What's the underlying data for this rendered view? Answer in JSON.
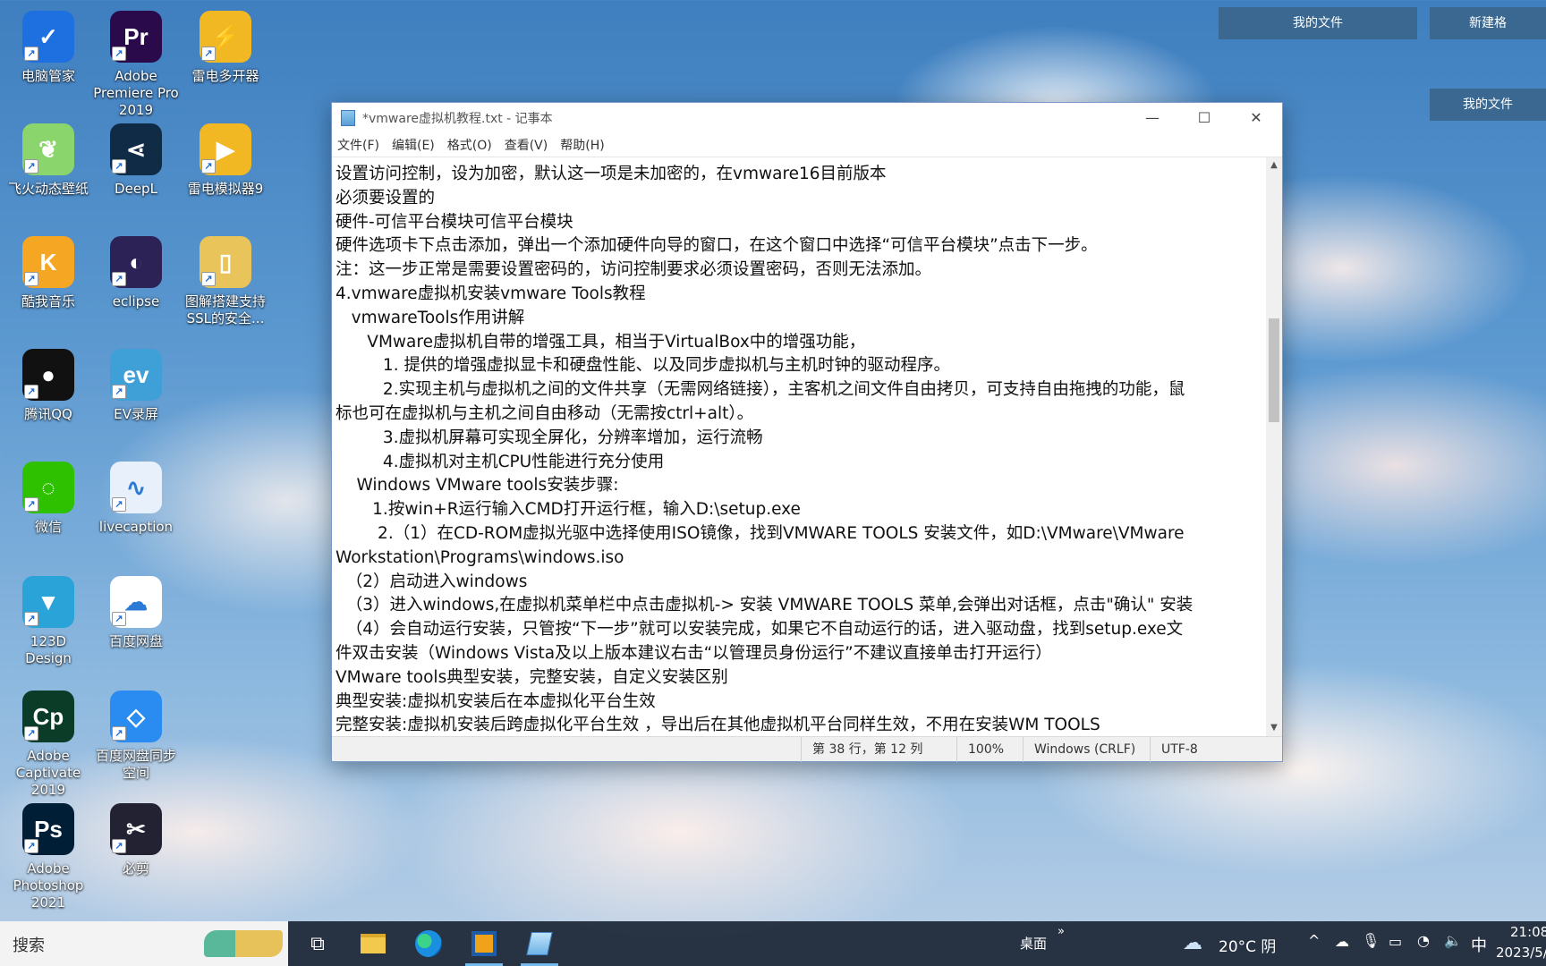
{
  "desktop": {
    "icons": [
      {
        "label": "电脑管家",
        "color": "#1e6fe0",
        "glyph": "✓",
        "icon": "shield-icon"
      },
      {
        "label": "Adobe Premiere Pro 2019",
        "color": "#2a0a4a",
        "glyph": "Pr",
        "icon": "premiere-icon"
      },
      {
        "label": "雷电多开器",
        "color": "#f2b824",
        "glyph": "⚡",
        "icon": "multi-open-icon"
      },
      {
        "label": "飞火动态壁纸",
        "color": "#8ad66c",
        "glyph": "❦",
        "icon": "leaf-icon"
      },
      {
        "label": "DeepL",
        "color": "#0f2b46",
        "glyph": "⋖",
        "icon": "deepl-icon"
      },
      {
        "label": "雷电模拟器9",
        "color": "#f2b824",
        "glyph": "▶",
        "icon": "emulator-icon"
      },
      {
        "label": "酷我音乐",
        "color": "#f5a623",
        "glyph": "K",
        "icon": "music-icon"
      },
      {
        "label": "eclipse",
        "color": "#2c2255",
        "glyph": "◐",
        "icon": "eclipse-icon"
      },
      {
        "label": "图解搭建支持SSL的安全...",
        "color": "#e9c45a",
        "glyph": "▯",
        "icon": "folder-icon"
      },
      {
        "label": "腾讯QQ",
        "color": "#111111",
        "glyph": "●",
        "icon": "qq-penguin-icon"
      },
      {
        "label": "EV录屏",
        "color": "#3fa0d8",
        "glyph": "ev",
        "icon": "ev-recorder-icon"
      },
      {
        "label": "微信",
        "color": "#2dc100",
        "glyph": "◌",
        "icon": "wechat-icon"
      },
      {
        "label": "livecaption",
        "color": "#e8f1fb",
        "glyph": "∿",
        "icon": "audio-wave-icon"
      },
      {
        "label": "123D Design",
        "color": "#29a3d8",
        "glyph": "▼",
        "icon": "123d-icon"
      },
      {
        "label": "百度网盘",
        "color": "#ffffff",
        "glyph": "☁",
        "icon": "baidu-cloud-icon"
      },
      {
        "label": "Adobe Captivate 2019",
        "color": "#0a3c28",
        "glyph": "Cp",
        "icon": "captivate-icon"
      },
      {
        "label": "百度网盘同步空间",
        "color": "#2a8cf0",
        "glyph": "◇",
        "icon": "sync-space-icon"
      },
      {
        "label": "Adobe Photoshop 2021",
        "color": "#001e36",
        "glyph": "Ps",
        "icon": "photoshop-icon"
      },
      {
        "label": "必剪",
        "color": "#222233",
        "glyph": "✂",
        "icon": "bijian-icon"
      }
    ],
    "floating": {
      "my_files_1": "我的文件",
      "new_tab": "新建格",
      "my_files_2": "我的文件"
    }
  },
  "notepad": {
    "title": "*vmware虚拟机教程.txt - 记事本",
    "menu": [
      "文件(F)",
      "编辑(E)",
      "格式(O)",
      "查看(V)",
      "帮助(H)"
    ],
    "lines": [
      "设置访问控制，设为加密，默认这一项是未加密的，在vmware16目前版本",
      "必须要设置的",
      "硬件-可信平台模块可信平台模块",
      "硬件选项卡下点击添加，弹出一个添加硬件向导的窗口，在这个窗口中选择“可信平台模块”点击下一步。",
      "注：这一步正常是需要设置密码的，访问控制要求必须设置密码，否则无法添加。",
      "4.vmware虚拟机安装vmware Tools教程",
      "   vmwareTools作用讲解",
      "      VMware虚拟机自带的增强工具，相当于VirtualBox中的增强功能，",
      "         1. 提供的增强虚拟显卡和硬盘性能、以及同步虚拟机与主机时钟的驱动程序。",
      "         2.实现主机与虚拟机之间的文件共享（无需网络链接），主客机之间文件自由拷贝，可支持自由拖拽的功能，鼠",
      "标也可在虚拟机与主机之间自由移动（无需按ctrl+alt）。",
      "         3.虚拟机屏幕可实现全屏化，分辨率增加，运行流畅",
      "         4.虚拟机对主机CPU性能进行充分使用",
      "    Windows VMware tools安装步骤:",
      "       1.按win+R运行输入CMD打开运行框，输入D:\\setup.exe",
      "        2.（1）在CD-ROM虚拟光驱中选择使用ISO镜像，找到VMWARE TOOLS 安装文件，如D:\\VMware\\VMware",
      "Workstation\\Programs\\windows.iso",
      "  （2）启动进入windows",
      "  （3）进入windows,在虚拟机菜单栏中点击虚拟机-> 安装 VMWARE TOOLS 菜单,会弹出对话框，点击\"确认\" 安装",
      "  （4）会自动运行安装，只管按“下一步”就可以安装完成，如果它不自动运行的话，进入驱动盘，找到setup.exe文",
      "件双击安装（Windows Vista及以上版本建议右击“以管理员身份运行”不建议直接单击打开运行）",
      "VMware tools典型安装，完整安装，自定义安装区别",
      "典型安装:虚拟机安装后在本虚拟化平台生效",
      "完整安装:虚拟机安装后跨虚拟化平台生效 ，导出后在其他虚拟机平台同样生效，不用在安装WM TOOLS"
    ],
    "status": {
      "position": "第 38 行，第 12 列",
      "zoom": "100%",
      "eol": "Windows (CRLF)",
      "encoding": "UTF-8"
    }
  },
  "taskbar": {
    "search_label": "搜索",
    "desktop_label": "桌面",
    "weather": "20°C 阴",
    "ime": "中",
    "time": "21:08",
    "date": "2023/5/"
  }
}
